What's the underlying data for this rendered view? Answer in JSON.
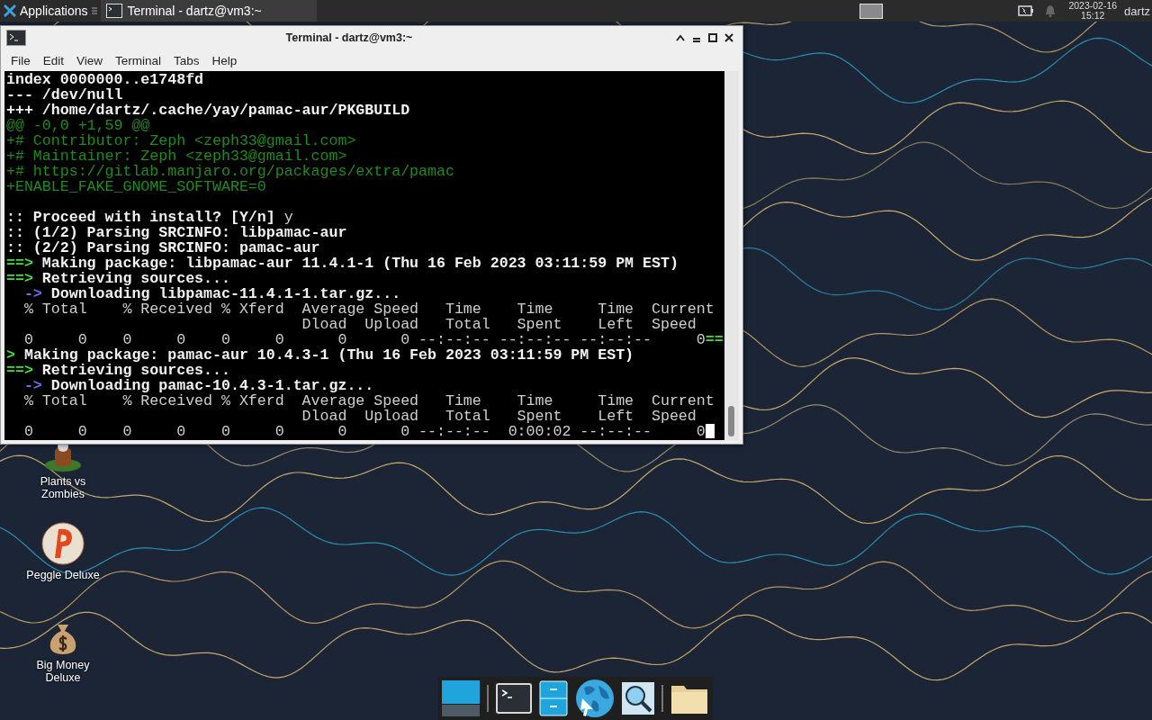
{
  "top_panel": {
    "applications_label": "Applications",
    "tasks": [
      {
        "label": "Terminal - dartz@vm3:~",
        "selected": true
      }
    ],
    "date": "2023-02-16",
    "time": "15:12",
    "user": "dartz"
  },
  "desktop_icons": [
    {
      "label": "Plants vs Zombies",
      "kind": "plant"
    },
    {
      "label": "Peggle Deluxe",
      "kind": "ball"
    },
    {
      "label": "Big Money Deluxe",
      "kind": "moneybag"
    }
  ],
  "window": {
    "title": "Terminal - dartz@vm3:~",
    "menu": [
      "File",
      "Edit",
      "View",
      "Terminal",
      "Tabs",
      "Help"
    ],
    "lines": [
      {
        "kind": "text",
        "spans": [
          {
            "t": "index 0000000..e1748fd",
            "kind": "bold"
          }
        ]
      },
      {
        "kind": "text",
        "spans": [
          {
            "t": "--- /dev/null",
            "kind": "bold"
          }
        ]
      },
      {
        "kind": "text",
        "spans": [
          {
            "t": "+++ /home/dartz/.cache/yay/pamac-aur/PKGBUILD",
            "kind": "bold"
          }
        ]
      },
      {
        "kind": "text",
        "spans": [
          {
            "t": "@@ -0,0 +1,59 @@",
            "kind": "green"
          }
        ]
      },
      {
        "kind": "text",
        "spans": [
          {
            "t": "+# Contributor: Zeph <zeph33@gmail.com>",
            "kind": "green"
          }
        ]
      },
      {
        "kind": "text",
        "spans": [
          {
            "t": "+# Maintainer: Zeph <zeph33@gmail.com>",
            "kind": "green"
          }
        ]
      },
      {
        "kind": "text",
        "spans": [
          {
            "t": "+# https://gitlab.manjaro.org/packages/extra/pamac",
            "kind": "green"
          }
        ]
      },
      {
        "kind": "text",
        "spans": [
          {
            "t": "+ENABLE_FAKE_GNOME_SOFTWARE=0",
            "kind": "green"
          }
        ]
      },
      {
        "kind": "blank"
      },
      {
        "kind": "text",
        "spans": [
          {
            "t": ":: Proceed with install? [Y/n] ",
            "kind": "bold"
          },
          {
            "t": "y",
            "kind": "plain"
          }
        ]
      },
      {
        "kind": "text",
        "spans": [
          {
            "t": ":: (1/2) Parsing SRCINFO: libpamac-aur",
            "kind": "bold"
          }
        ]
      },
      {
        "kind": "text",
        "spans": [
          {
            "t": ":: (2/2) Parsing SRCINFO: pamac-aur",
            "kind": "bold"
          }
        ]
      },
      {
        "kind": "text",
        "spans": [
          {
            "t": "==>",
            "kind": "arrow"
          },
          {
            "t": " Making package: libpamac-aur 11.4.1-1 (Thu 16 Feb 2023 03:11:59 PM EST)",
            "kind": "bold"
          }
        ]
      },
      {
        "kind": "text",
        "spans": [
          {
            "t": "==>",
            "kind": "arrow"
          },
          {
            "t": " Retrieving sources...",
            "kind": "bold"
          }
        ]
      },
      {
        "kind": "text",
        "spans": [
          {
            "t": "  ->",
            "kind": "blue"
          },
          {
            "t": " Downloading libpamac-11.4.1-1.tar.gz...",
            "kind": "bold"
          }
        ]
      },
      {
        "kind": "text",
        "spans": [
          {
            "t": "  % Total    % Received % Xferd  Average Speed   Time    Time     Time  Current",
            "kind": "plain"
          }
        ]
      },
      {
        "kind": "text",
        "spans": [
          {
            "t": "                                 Dload  Upload   Total   Spent    Left  Speed",
            "kind": "plain"
          }
        ]
      },
      {
        "kind": "text",
        "spans": [
          {
            "t": "  0     0    0     0    0     0      0      0 --:--:-- --:--:-- --:--:--     0",
            "kind": "plain"
          },
          {
            "t": "==",
            "kind": "arrow"
          }
        ]
      },
      {
        "kind": "text",
        "spans": [
          {
            "t": ">",
            "kind": "arrow"
          },
          {
            "t": " Making package: pamac-aur 10.4.3-1 (Thu 16 Feb 2023 03:11:59 PM EST)",
            "kind": "bold"
          }
        ]
      },
      {
        "kind": "text",
        "spans": [
          {
            "t": "==>",
            "kind": "arrow"
          },
          {
            "t": " Retrieving sources...",
            "kind": "bold"
          }
        ]
      },
      {
        "kind": "text",
        "spans": [
          {
            "t": "  ->",
            "kind": "blue"
          },
          {
            "t": " Downloading pamac-10.4.3-1.tar.gz...",
            "kind": "bold"
          }
        ]
      },
      {
        "kind": "text",
        "spans": [
          {
            "t": "  % Total    % Received % Xferd  Average Speed   Time    Time     Time  Current",
            "kind": "plain"
          }
        ]
      },
      {
        "kind": "text",
        "spans": [
          {
            "t": "                                 Dload  Upload   Total   Spent    Left  Speed",
            "kind": "plain"
          }
        ]
      },
      {
        "kind": "text",
        "spans": [
          {
            "t": "  0     0    0     0    0     0      0      0 --:--:--  0:00:02 --:--:--     0",
            "kind": "plain"
          }
        ]
      }
    ]
  },
  "dock": [
    {
      "kind": "desktop"
    },
    {
      "kind": "terminal"
    },
    {
      "kind": "files"
    },
    {
      "kind": "browser"
    },
    {
      "kind": "search"
    },
    {
      "kind": "folder"
    }
  ]
}
